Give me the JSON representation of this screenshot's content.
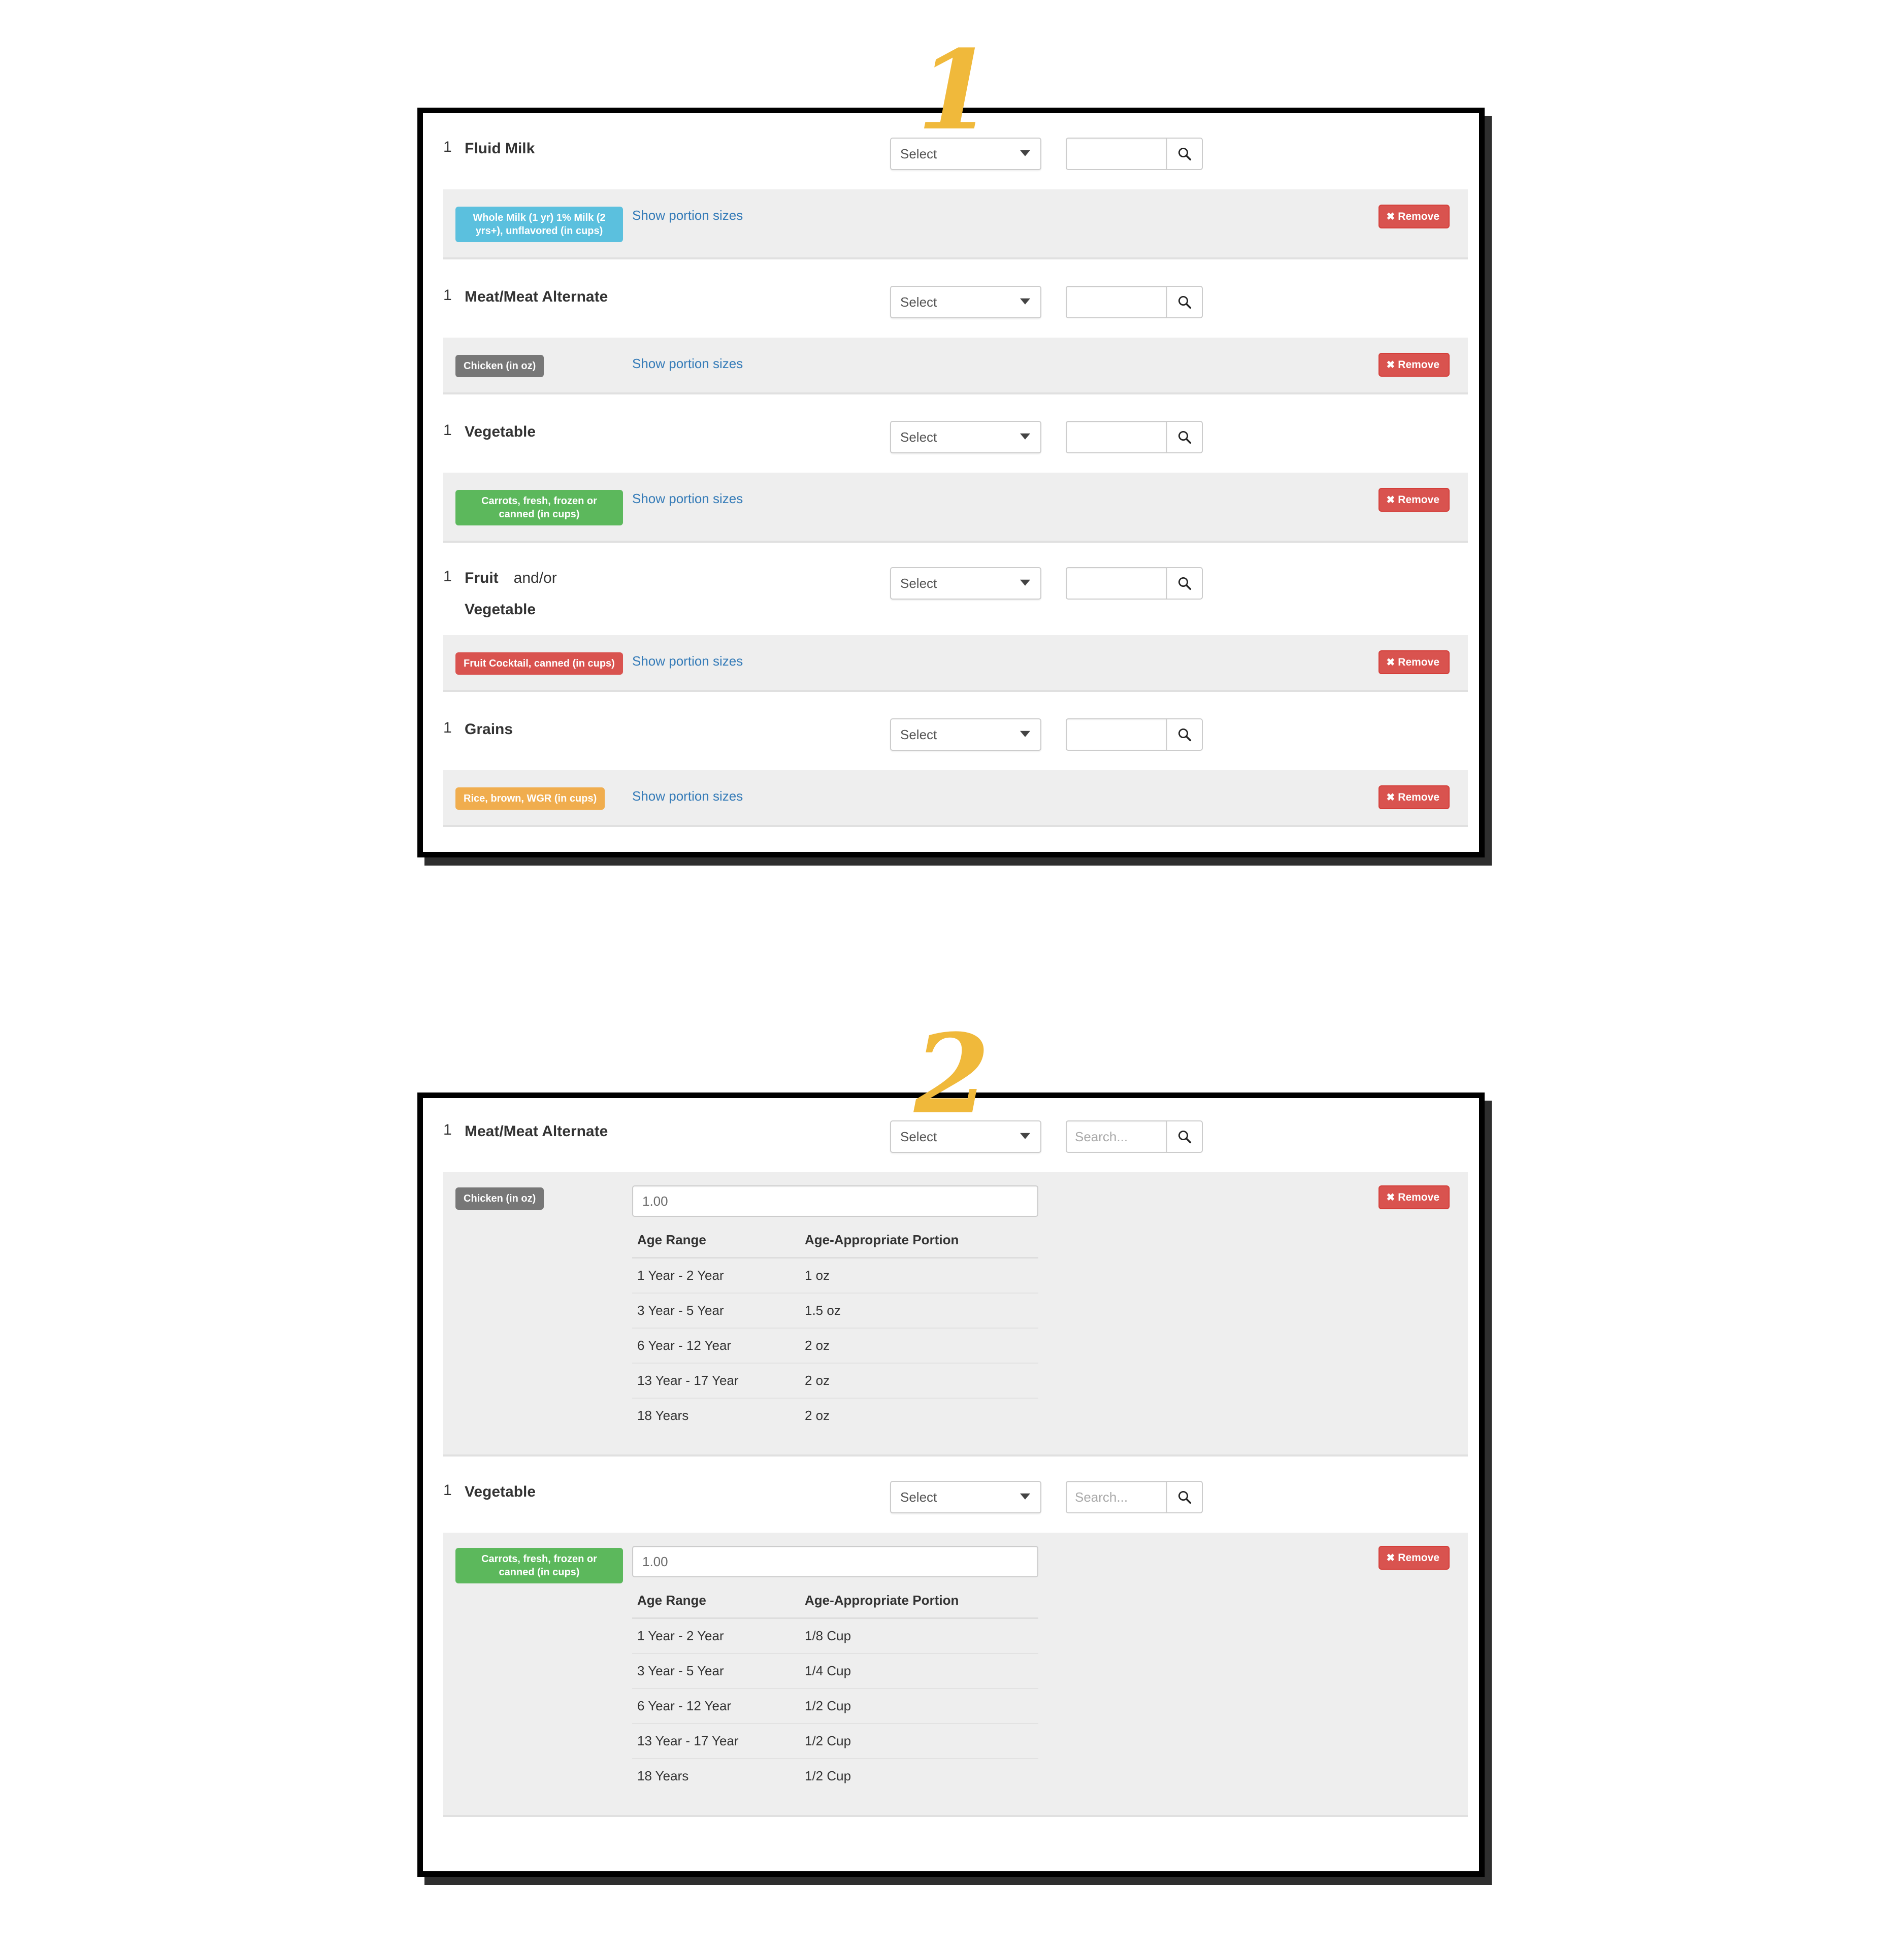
{
  "markers": {
    "step_one": "1",
    "step_two": "2"
  },
  "common": {
    "select_label": "Select",
    "portion_link": "Show portion sizes",
    "remove_label": "Remove",
    "remove_icon_glyph": "✖",
    "search_icon": "search-icon",
    "chevron_icon": "chevron-down-icon",
    "search_placeholder_empty": "",
    "search_placeholder": "Search...",
    "table_headers": {
      "age_range": "Age Range",
      "portion": "Age-Appropriate Portion"
    }
  },
  "panel_one": {
    "rows": [
      {
        "number": "1",
        "label": "Fluid Milk",
        "select_value": "Select",
        "search_value": "",
        "search_placeholder": "",
        "item": {
          "badge_text": "Whole Milk (1 yr) 1% Milk (2 yrs+), unflavored (in cups)",
          "badge_color": "#5bc0de",
          "badge_style": "blue",
          "portion_link": "Show portion sizes",
          "remove_label": "Remove"
        }
      },
      {
        "number": "1",
        "label": "Meat/Meat Alternate",
        "select_value": "Select",
        "search_value": "",
        "search_placeholder": "",
        "item": {
          "badge_text": "Chicken (in oz)",
          "badge_color": "#777777",
          "badge_style": "gray",
          "portion_link": "Show portion sizes",
          "remove_label": "Remove"
        }
      },
      {
        "number": "1",
        "label": "Vegetable",
        "select_value": "Select",
        "search_value": "",
        "search_placeholder": "",
        "item": {
          "badge_text": "Carrots, fresh, frozen or canned (in cups)",
          "badge_color": "#5cb85c",
          "badge_style": "green",
          "portion_link": "Show portion sizes",
          "remove_label": "Remove"
        }
      },
      {
        "number": "1",
        "label": "Fruit",
        "label_suffix": "and/or",
        "label_second_line": "Vegetable",
        "select_value": "Select",
        "search_value": "",
        "search_placeholder": "",
        "item": {
          "badge_text": "Fruit Cocktail, canned (in cups)",
          "badge_color": "#d9534f",
          "badge_style": "red",
          "portion_link": "Show portion sizes",
          "remove_label": "Remove"
        }
      },
      {
        "number": "1",
        "label": "Grains",
        "select_value": "Select",
        "search_value": "",
        "search_placeholder": "",
        "item": {
          "badge_text": "Rice, brown, WGR (in cups)",
          "badge_color": "#f0ad4e",
          "badge_style": "orange",
          "portion_link": "Show portion sizes",
          "remove_label": "Remove"
        }
      }
    ]
  },
  "panel_two": {
    "rows": [
      {
        "number": "1",
        "label": "Meat/Meat Alternate",
        "select_value": "Select",
        "search_value": "",
        "search_placeholder": "Search...",
        "item": {
          "badge_text": "Chicken (in oz)",
          "badge_color": "#777777",
          "badge_style": "gray",
          "quantity": "1.00",
          "remove_label": "Remove",
          "table": {
            "headers": [
              "Age Range",
              "Age-Appropriate Portion"
            ],
            "rows": [
              [
                "1 Year - 2 Year",
                "1 oz"
              ],
              [
                "3 Year - 5 Year",
                "1.5 oz"
              ],
              [
                "6 Year - 12 Year",
                "2 oz"
              ],
              [
                "13 Year - 17 Year",
                "2 oz"
              ],
              [
                "18 Years",
                "2 oz"
              ]
            ]
          }
        }
      },
      {
        "number": "1",
        "label": "Vegetable",
        "select_value": "Select",
        "search_value": "",
        "search_placeholder": "Search...",
        "item": {
          "badge_text": "Carrots, fresh, frozen or canned (in cups)",
          "badge_color": "#5cb85c",
          "badge_style": "green",
          "quantity": "1.00",
          "remove_label": "Remove",
          "table": {
            "headers": [
              "Age Range",
              "Age-Appropriate Portion"
            ],
            "rows": [
              [
                "1 Year - 2 Year",
                "1/8 Cup"
              ],
              [
                "3 Year - 5 Year",
                "1/4 Cup"
              ],
              [
                "6 Year - 12 Year",
                "1/2 Cup"
              ],
              [
                "13 Year - 17 Year",
                "1/2 Cup"
              ],
              [
                "18 Years",
                "1/2 Cup"
              ]
            ]
          }
        }
      }
    ]
  }
}
